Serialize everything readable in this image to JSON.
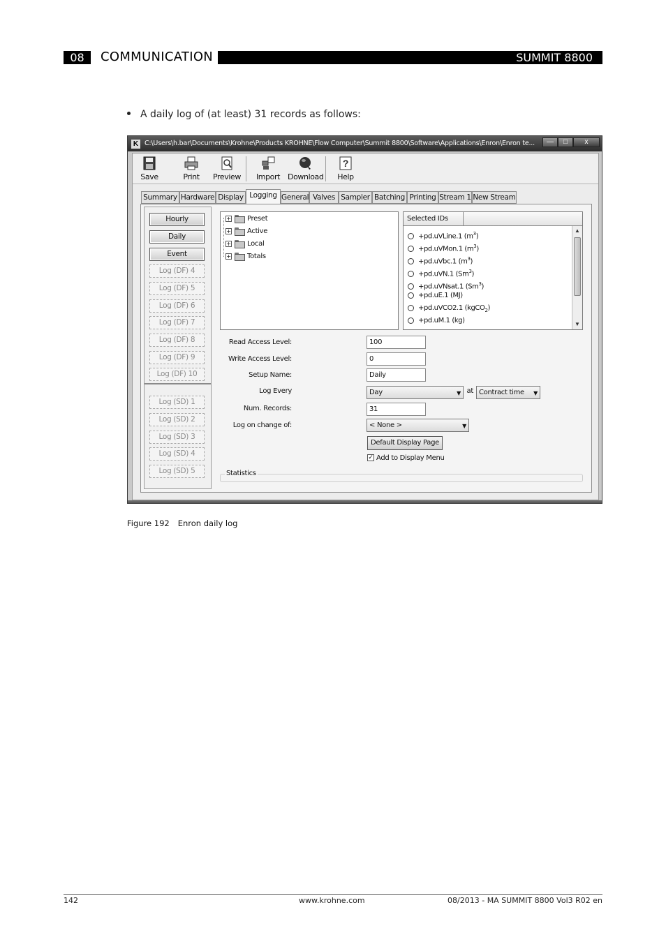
{
  "header": {
    "chapter_num": "08",
    "chapter_title": "COMMUNICATION",
    "product": "SUMMIT 8800"
  },
  "bullet_text": "A daily log of (at least) 31 records as follows:",
  "window": {
    "app_icon": "K",
    "title": "C:\\Users\\h.bar\\Documents\\Krohne\\Products KROHNE\\Flow Computer\\Summit 8800\\Software\\Applications\\Enron\\Enron te...",
    "controls": {
      "minimize": "—",
      "maximize": "□",
      "close": "x"
    },
    "toolbar": [
      {
        "label": "Save",
        "icon": "floppy-disk-icon"
      },
      {
        "label": "Print",
        "icon": "printer-icon"
      },
      {
        "label": "Preview",
        "icon": "print-preview-icon"
      },
      {
        "label": "Import",
        "icon": "import-icon"
      },
      {
        "label": "Download",
        "icon": "download-globe-icon"
      },
      {
        "label": "Help",
        "icon": "help-icon"
      }
    ],
    "tabs": [
      "Summary",
      "Hardware",
      "Display",
      "Logging",
      "General",
      "Valves",
      "Sampler",
      "Batching",
      "Printing",
      "Stream 1",
      "New Stream"
    ],
    "active_tab": "Logging",
    "log_buttons": [
      "Hourly",
      "Daily",
      "Event",
      "Log (DF) 4",
      "Log (DF) 5",
      "Log (DF) 6",
      "Log (DF) 7",
      "Log (DF) 8",
      "Log (DF) 9",
      "Log (DF) 10"
    ],
    "log_sd_buttons": [
      "Log (SD) 1",
      "Log (SD) 2",
      "Log (SD) 3",
      "Log (SD) 4",
      "Log (SD) 5"
    ],
    "tree": [
      {
        "expand": "+",
        "label": "Preset"
      },
      {
        "expand": "+",
        "label": "Active"
      },
      {
        "expand": "+",
        "label": "Local"
      },
      {
        "expand": "+",
        "label": "Totals"
      }
    ],
    "selected_ids_header": "Selected IDs",
    "selected_ids": [
      {
        "name": "+pd.uVLine.1 (m",
        "sup": "3",
        "sub": "",
        "tail": ")"
      },
      {
        "name": "+pd.uVMon.1 (m",
        "sup": "3",
        "sub": "",
        "tail": ")"
      },
      {
        "name": "+pd.uVbc.1 (m",
        "sup": "3",
        "sub": "",
        "tail": ")"
      },
      {
        "name": "+pd.uVN.1 (Sm",
        "sup": "3",
        "sub": "",
        "tail": ")"
      },
      {
        "name": "+pd.uVNsat.1 (Sm",
        "sup": "3",
        "sub": "",
        "tail": ")"
      },
      {
        "name": "+pd.uE.1 (MJ)",
        "sup": "",
        "sub": "",
        "tail": ""
      },
      {
        "name": "+pd.uVCO2.1 (kgCO",
        "sup": "",
        "sub": "2",
        "tail": ")"
      },
      {
        "name": "+pd.uM.1 (kg)",
        "sup": "",
        "sub": "",
        "tail": ""
      }
    ],
    "form": {
      "read_access_label": "Read Access Level:",
      "read_access_value": "100",
      "write_access_label": "Write Access Level:",
      "write_access_value": "0",
      "setup_name_label": "Setup Name:",
      "setup_name_value": "Daily",
      "log_every_label": "Log Every",
      "log_every_value": "Day",
      "at_label": "at",
      "at_value": "Contract time",
      "num_records_label": "Num. Records:",
      "num_records_value": "31",
      "log_change_label": "Log on change of:",
      "log_change_value": "< None >",
      "default_display_button": "Default Display Page",
      "add_to_menu_label": "Add to Display Menu",
      "add_to_menu_checked": "✓",
      "statistics_label": "Statistics"
    }
  },
  "caption": {
    "number": "Figure 192",
    "text": "Enron daily log"
  },
  "footer": {
    "page": "142",
    "url": "www.krohne.com",
    "doc": "08/2013 - MA SUMMIT 8800 Vol3 R02 en"
  }
}
